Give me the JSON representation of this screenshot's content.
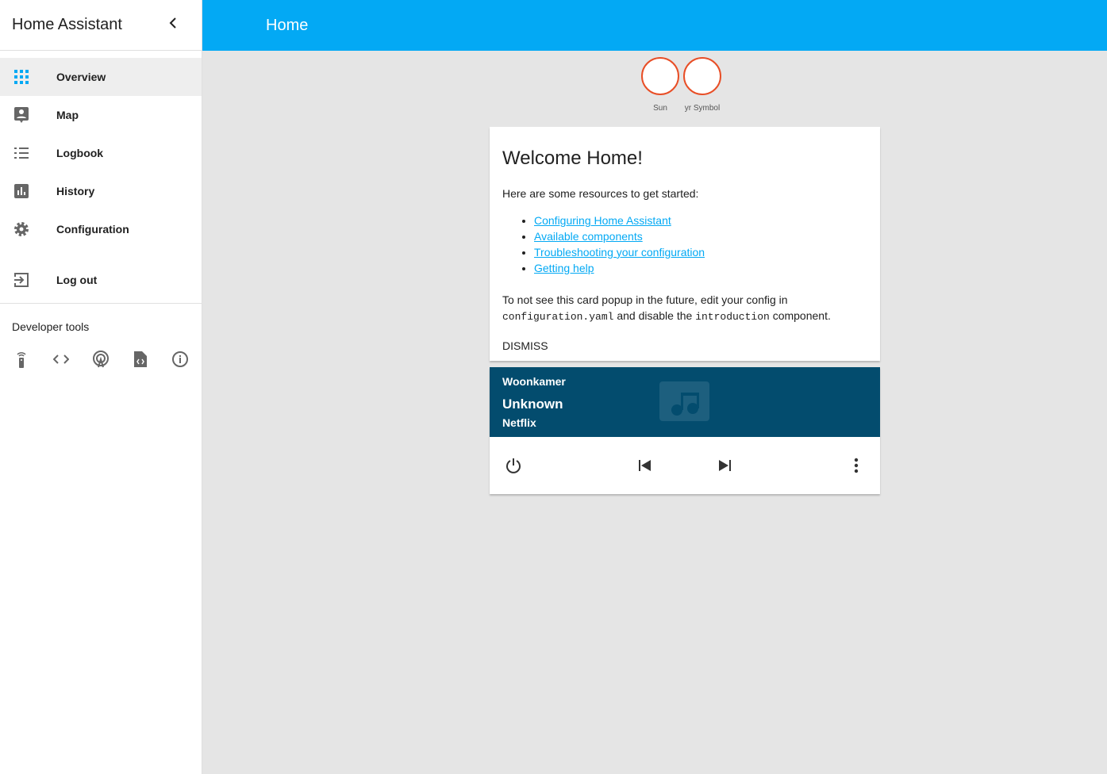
{
  "sidebar": {
    "title": "Home Assistant",
    "items": [
      {
        "label": "Overview"
      },
      {
        "label": "Map"
      },
      {
        "label": "Logbook"
      },
      {
        "label": "History"
      },
      {
        "label": "Configuration"
      },
      {
        "label": "Log out"
      }
    ],
    "dev_tools_label": "Developer tools"
  },
  "header": {
    "title": "Home"
  },
  "badges": [
    {
      "label": "Sun"
    },
    {
      "label": "yr Symbol"
    }
  ],
  "welcome": {
    "title": "Welcome Home!",
    "intro": "Here are some resources to get started:",
    "links": [
      "Configuring Home Assistant",
      "Available components",
      "Troubleshooting your configuration",
      "Getting help"
    ],
    "note1": "To not see this card popup in the future, edit your config in",
    "code1": "configuration.yaml",
    "note2": " and disable the ",
    "code2": "introduction",
    "note3": " component.",
    "dismiss": "DISMISS"
  },
  "player": {
    "name": "Woonkamer",
    "title": "Unknown",
    "app": "Netflix"
  },
  "colors": {
    "accent": "#03a9f4",
    "player_bg": "#034c6e",
    "badge_border": "#e84e26"
  }
}
